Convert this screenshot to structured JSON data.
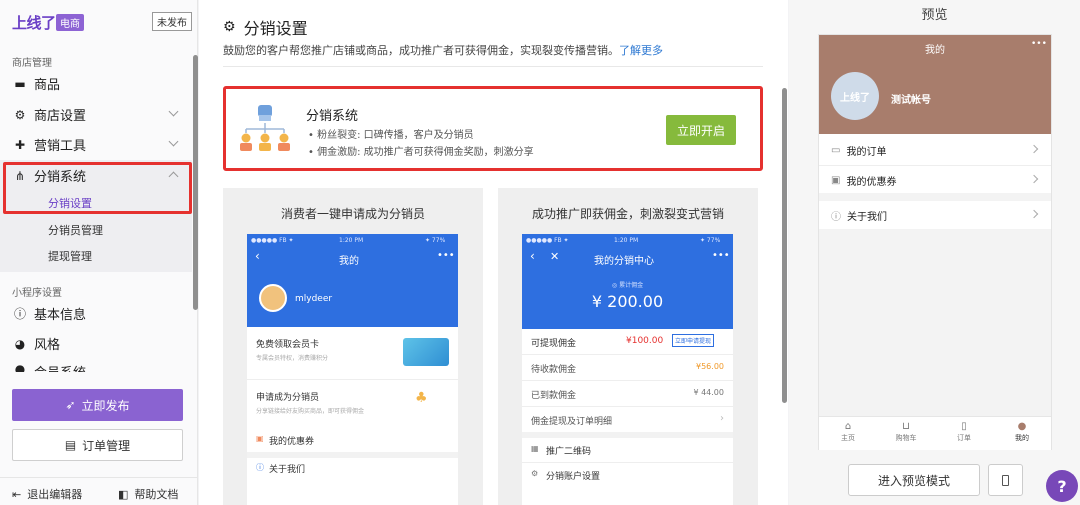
{
  "sidebar": {
    "logo": "上线了",
    "edition": "电商",
    "publish_status": "未发布",
    "shop_section": "商店管理",
    "items": [
      {
        "label": "商品"
      },
      {
        "label": "商店设置"
      },
      {
        "label": "营销工具"
      },
      {
        "label": "分销系统"
      }
    ],
    "subitems": [
      {
        "label": "分销设置"
      },
      {
        "label": "分销员管理"
      },
      {
        "label": "提现管理"
      }
    ],
    "mini_section": "小程序设置",
    "mini_items": [
      {
        "label": "基本信息"
      },
      {
        "label": "风格"
      },
      {
        "label": "会员系统"
      }
    ],
    "publish_button": "立即发布",
    "orders_button": "订单管理",
    "exit_editor": "退出编辑器",
    "help_docs": "帮助文档"
  },
  "main": {
    "title": "分销设置",
    "description": "鼓励您的客户帮您推广店铺或商品，成功推广者可获得佣金，实现裂变传播营销。",
    "learn_more": "了解更多",
    "card": {
      "title": "分销系统",
      "bullets": [
        "粉丝裂变: 口碑传播，客户及分销员",
        "佣金激励: 成功推广者可获得佣金奖励，刺激分享"
      ],
      "button": "立即开启"
    },
    "panel_left": {
      "caption": "消费者一键申请成为分销员",
      "status_left": "●●●●● FB ✦",
      "status_time": "1:20 PM",
      "status_right": "✦ 77%",
      "nav_title": "我的",
      "username": "mlydeer",
      "row1_title": "免费领取会员卡",
      "row1_sub": "专属会员特权，消费赚积分",
      "row2_title": "申请成为分销员",
      "row2_sub": "分享链接给好友购买商品，即可获得佣金",
      "row3": "我的优惠券",
      "row4": "关于我们"
    },
    "panel_right": {
      "caption": "成功推广即获佣金，刺激裂变式营销",
      "status_left": "●●●●● FB ✦",
      "status_time": "1:20 PM",
      "status_right": "✦ 77%",
      "nav_title": "我的分销中心",
      "total_label": "◎ 累计佣金",
      "total": "¥ 200.00",
      "rows": [
        {
          "label": "可提现佣金",
          "value": "¥100.00",
          "tag": "立即申请提现"
        },
        {
          "label": "待收款佣金",
          "value": "¥56.00"
        },
        {
          "label": "已到款佣金",
          "value": "¥ 44.00"
        },
        {
          "label": "佣金提现及订单明细",
          "value": ""
        }
      ],
      "row_qr": "推广二维码",
      "row_account": "分销账户设置"
    }
  },
  "preview": {
    "title": "预览",
    "phone_title": "我的",
    "more": "•••",
    "avatar_text": "上线了",
    "account": "测试帐号",
    "rows": [
      "我的订单",
      "我的优惠券",
      "关于我们"
    ],
    "tabs": [
      "主页",
      "购物车",
      "订单",
      "我的"
    ],
    "enter_preview": "进入预览模式",
    "help": "?"
  },
  "colors": {
    "accent": "#8a63d1",
    "highlight": "#e5312f",
    "green": "#86ba3c",
    "blue": "#2e6fe0"
  }
}
